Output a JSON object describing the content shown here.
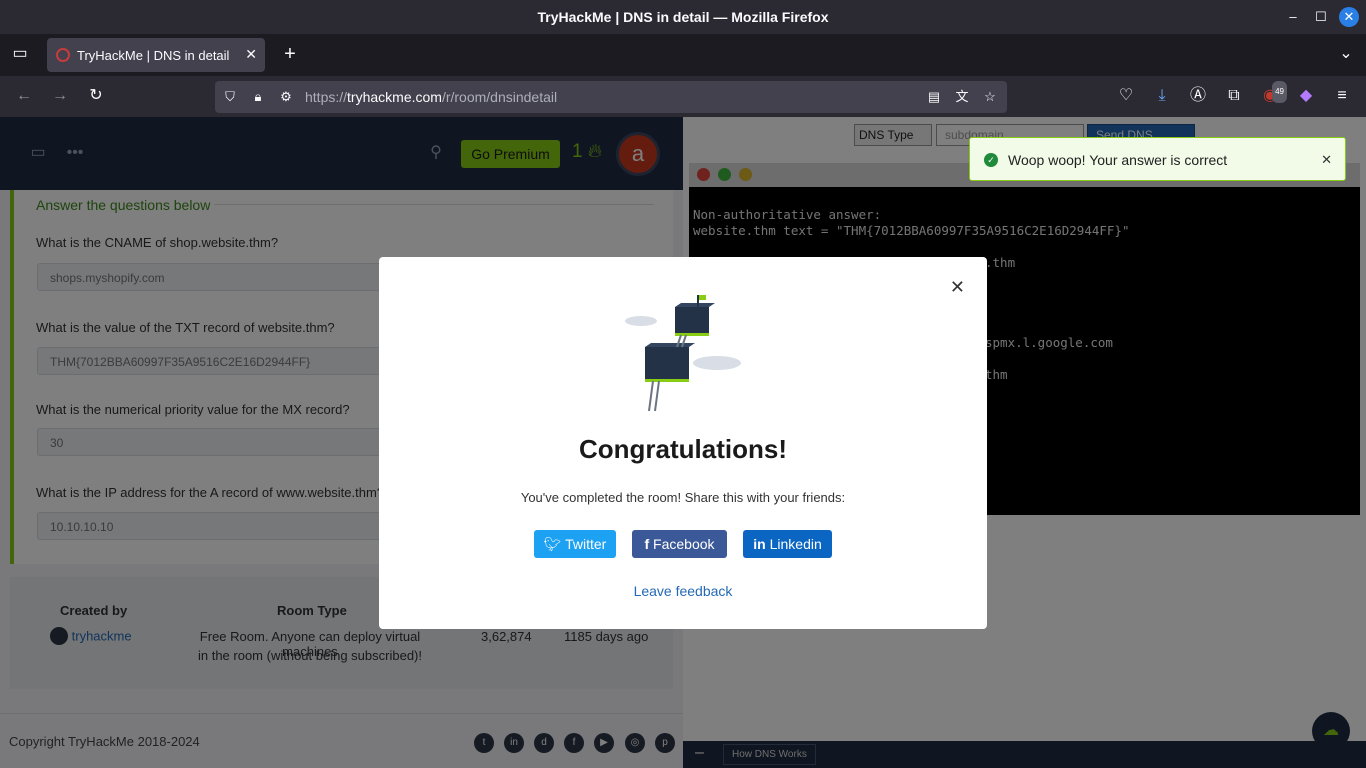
{
  "window": {
    "title": "TryHackMe | DNS in detail — Mozilla Firefox"
  },
  "browser": {
    "tab_title": "TryHackMe | DNS in detail",
    "url_prefix": "https://",
    "url_host": "tryhackme.com",
    "url_path": "/r/room/dnsindetail",
    "extension_badge": "49"
  },
  "thm_nav": {
    "premium_label": "Go Premium",
    "streak": "1",
    "avatar_letter": "a"
  },
  "questions": {
    "heading": "Answer the questions below",
    "items": [
      {
        "question": "What is the CNAME of shop.website.thm?",
        "answer": "shops.myshopify.com"
      },
      {
        "question": "What is the value of the TXT record of website.thm?",
        "answer": "THM{7012BBA60997F35A9516C2E16D2944FF}"
      },
      {
        "question": "What is the numerical priority value for the MX record?",
        "answer": "30"
      },
      {
        "question": "What is the IP address for the A record of www.website.thm?",
        "answer": "10.10.10.10"
      }
    ]
  },
  "room_info": {
    "created_by_label": "Created by",
    "creator": "tryhackme",
    "room_type_label": "Room Type",
    "room_type_line1": "Free Room. Anyone can deploy virtual machines",
    "room_type_line2": "in the room (without being subscribed)!",
    "users": "3,62,874",
    "created": "1185 days ago"
  },
  "footer": {
    "copyright": "Copyright TryHackMe 2018-2024"
  },
  "dns_tool": {
    "type_label": "DNS Type",
    "input_placeholder": "subdomain",
    "send_label": "Send DNS Request",
    "terminal_lines": [
      "Non-authoritative answer:",
      "website.thm text = \"THM{7012BBA60997F35A9516C2E16D2944FF}\"",
      ".thm",
      "spmx.l.google.com",
      "thm"
    ],
    "bottom_chip": "How DNS Works"
  },
  "toast": {
    "message": "Woop woop! Your answer is correct"
  },
  "modal": {
    "title": "Congratulations!",
    "subtitle": "You've completed the room! Share this with your friends:",
    "twitter": "Twitter",
    "facebook": "Facebook",
    "linkedin": "Linkedin",
    "feedback": "Leave feedback",
    "colors": {
      "twitter": "#1da1f2",
      "facebook": "#3b5998",
      "linkedin": "#0a66c2"
    }
  }
}
